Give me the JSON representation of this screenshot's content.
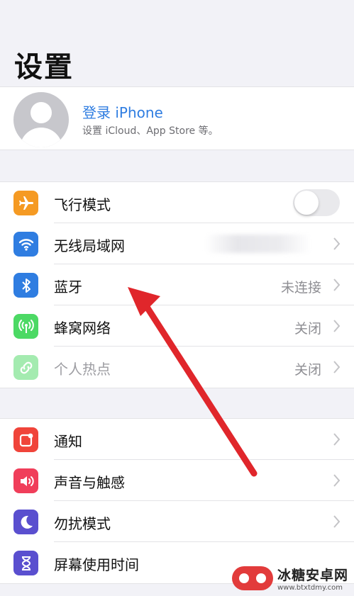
{
  "page": {
    "title": "设置"
  },
  "profile": {
    "name": "登录 iPhone",
    "subtitle": "设置 iCloud、App Store 等。"
  },
  "section1": [
    {
      "label": "飞行模式",
      "icon": "airplane-icon",
      "color": "#f59a23",
      "toggle_on": false
    },
    {
      "label": "无线局域网",
      "icon": "wifi-icon",
      "color": "#2f7de1",
      "value": ""
    },
    {
      "label": "蓝牙",
      "icon": "bluetooth-icon",
      "color": "#2f7de1",
      "value": "未连接"
    },
    {
      "label": "蜂窝网络",
      "icon": "antenna-icon",
      "color": "#4cd964",
      "value": "关闭"
    },
    {
      "label": "个人热点",
      "icon": "link-icon",
      "color": "#4cd964",
      "value": "关闭",
      "disabled": true
    }
  ],
  "section2": [
    {
      "label": "通知",
      "icon": "notification-icon",
      "color": "#f0443a"
    },
    {
      "label": "声音与触感",
      "icon": "speaker-icon",
      "color": "#f03e5a"
    },
    {
      "label": "勿扰模式",
      "icon": "moon-icon",
      "color": "#5a4fcf"
    },
    {
      "label": "屏幕使用时间",
      "icon": "hourglass-icon",
      "color": "#5a4fcf"
    }
  ],
  "watermark": {
    "name": "冰糖安卓网",
    "url": "www.btxtdmy.com"
  },
  "colors": {
    "arrow": "#e0262b",
    "link": "#2f7de1"
  }
}
